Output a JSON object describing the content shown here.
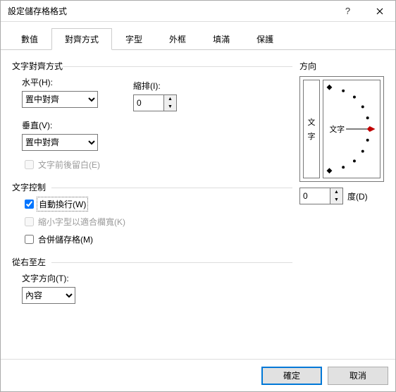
{
  "window": {
    "title": "設定儲存格格式"
  },
  "tabs": [
    "數值",
    "對齊方式",
    "字型",
    "外框",
    "填滿",
    "保護"
  ],
  "active_tab_index": 1,
  "align": {
    "group": "文字對齊方式",
    "horizontal_label": "水平(H):",
    "horizontal_value": "置中對齊",
    "indent_label": "縮排(I):",
    "indent_value": "0",
    "vertical_label": "垂直(V):",
    "vertical_value": "置中對齊",
    "leading_space": "文字前後留白(E)"
  },
  "textctrl": {
    "group": "文字控制",
    "wrap": "自動換行(W)",
    "shrink": "縮小字型以適合欄寬(K)",
    "merge": "合併儲存格(M)"
  },
  "rtl": {
    "group": "從右至左",
    "dir_label": "文字方向(T):",
    "dir_value": "內容"
  },
  "orient": {
    "group": "方向",
    "vertical_text_1": "文",
    "vertical_text_2": "字",
    "inner_text": "文字",
    "degree_value": "0",
    "degree_label": "度(D)"
  },
  "footer": {
    "ok": "確定",
    "cancel": "取消"
  }
}
